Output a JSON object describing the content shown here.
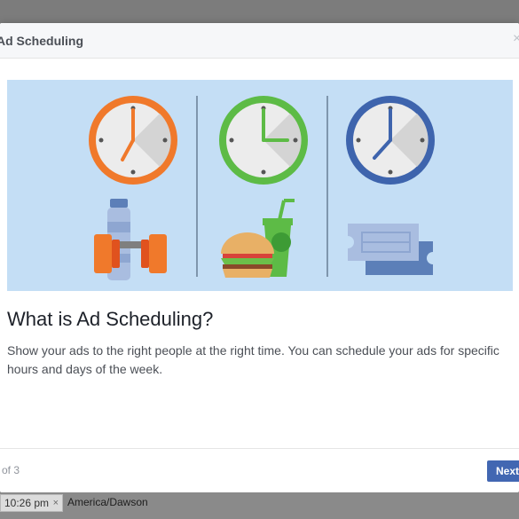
{
  "dialog": {
    "title": "Ad Scheduling",
    "heading": "What is Ad Scheduling?",
    "description": "Show your ads to the right people at the right time. You can schedule your ads for specific hours and days of the week.",
    "pager": "of 3",
    "next_label": "Next",
    "close_glyph": "×"
  },
  "illustration": {
    "background": "#c4def5",
    "clocks": [
      {
        "name": "morning-clock-icon",
        "ring": "#f0792b"
      },
      {
        "name": "noon-clock-icon",
        "ring": "#5dbb46"
      },
      {
        "name": "evening-clock-icon",
        "ring": "#3e64ad"
      }
    ],
    "items": [
      "dumbbell-water-bottle-icon",
      "burger-drink-icon",
      "ticket-icon"
    ]
  },
  "timebar": {
    "time": "10:26 pm",
    "remove_glyph": "×",
    "timezone": "America/Dawson"
  },
  "colors": {
    "button": "#4267b2",
    "heading": "#1d2129",
    "text": "#4b4f56"
  }
}
